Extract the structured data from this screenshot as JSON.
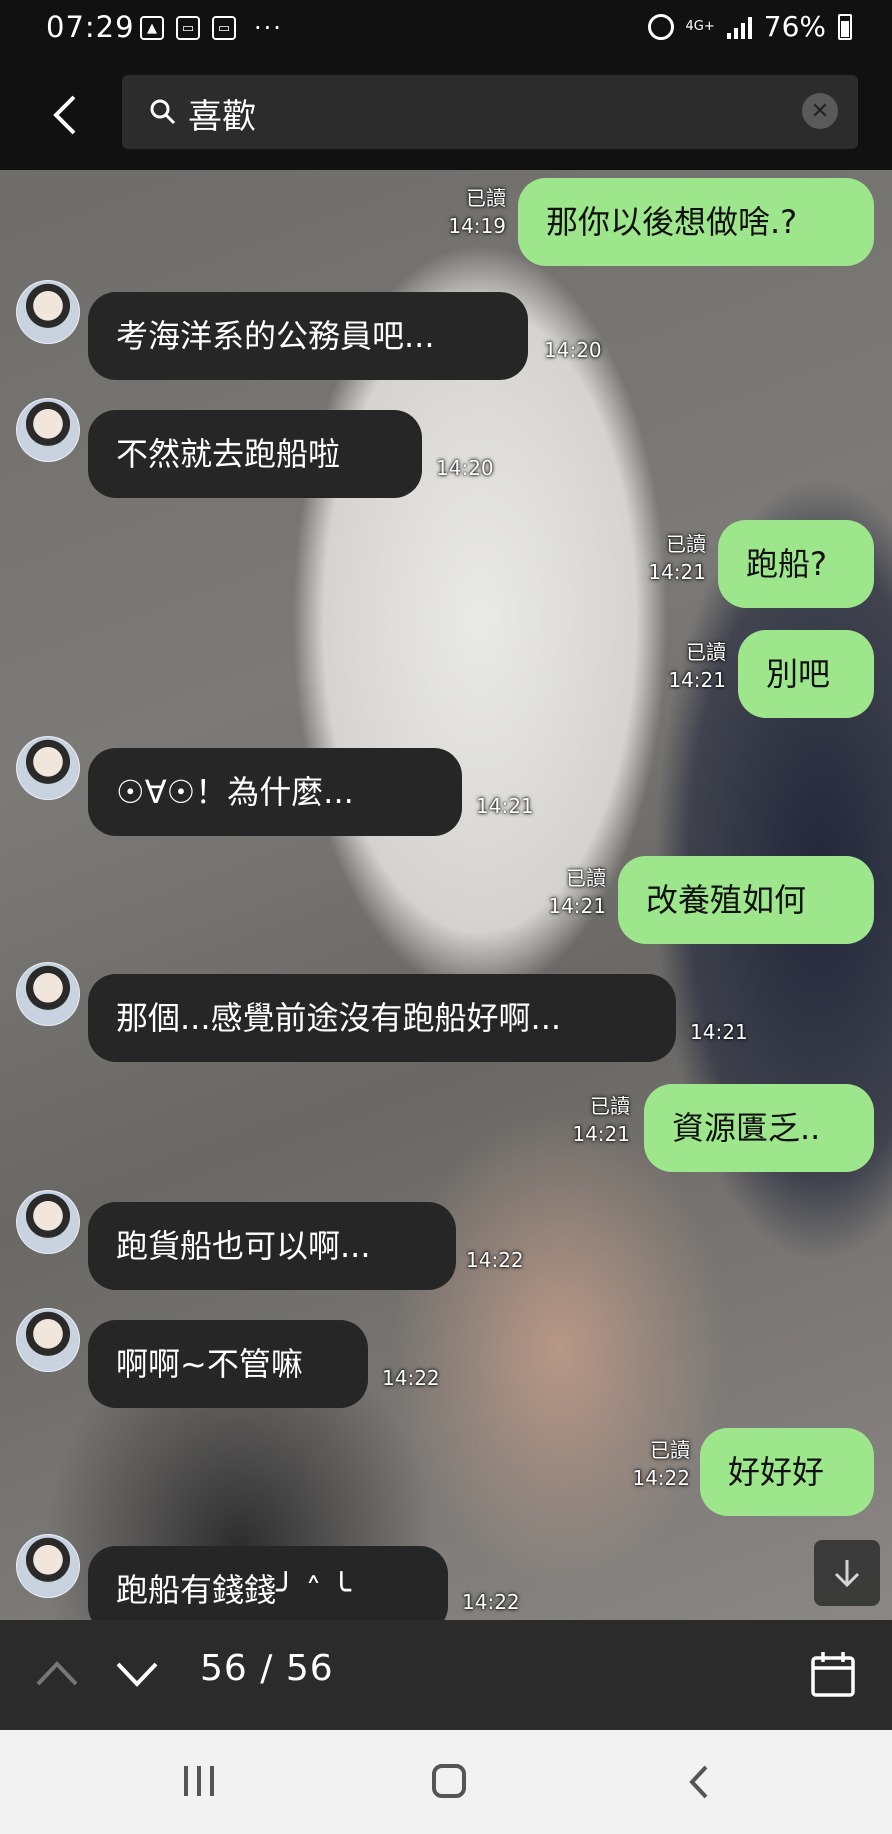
{
  "status_bar": {
    "time": "07:29",
    "network": "4G+",
    "battery": "76%",
    "overflow": "···"
  },
  "header": {
    "search_query": "喜歡"
  },
  "messages": [
    {
      "dir": "out",
      "text": "那你以後想做啥.?",
      "read": "已讀",
      "time": "14:19"
    },
    {
      "dir": "in",
      "text": "考海洋系的公務員吧...",
      "time": "14:20"
    },
    {
      "dir": "in",
      "text": "不然就去跑船啦",
      "time": "14:20"
    },
    {
      "dir": "out",
      "text": "跑船?",
      "read": "已讀",
      "time": "14:21"
    },
    {
      "dir": "out",
      "text": "別吧",
      "read": "已讀",
      "time": "14:21"
    },
    {
      "dir": "in",
      "text": "☉∀☉！為什麼...",
      "time": "14:21"
    },
    {
      "dir": "out",
      "text": "改養殖如何",
      "read": "已讀",
      "time": "14:21"
    },
    {
      "dir": "in",
      "text": "那個...感覺前途沒有跑船好啊...",
      "time": "14:21"
    },
    {
      "dir": "out",
      "text": "資源匱乏..",
      "read": "已讀",
      "time": "14:21"
    },
    {
      "dir": "in",
      "text": "跑貨船也可以啊...",
      "time": "14:22"
    },
    {
      "dir": "in",
      "text": "啊啊~不管嘛",
      "time": "14:22"
    },
    {
      "dir": "out",
      "text": "好好好",
      "read": "已讀",
      "time": "14:22"
    },
    {
      "dir": "in",
      "text": "跑船有錢錢╯ ˄ ╰",
      "time": "14:22"
    }
  ],
  "search_nav": {
    "counter": "56 / 56"
  },
  "colors": {
    "bubble_in": "#262626",
    "bubble_out": "#9ee68c",
    "bar_bg": "#111111",
    "nav_bg": "#2b2b2b"
  }
}
